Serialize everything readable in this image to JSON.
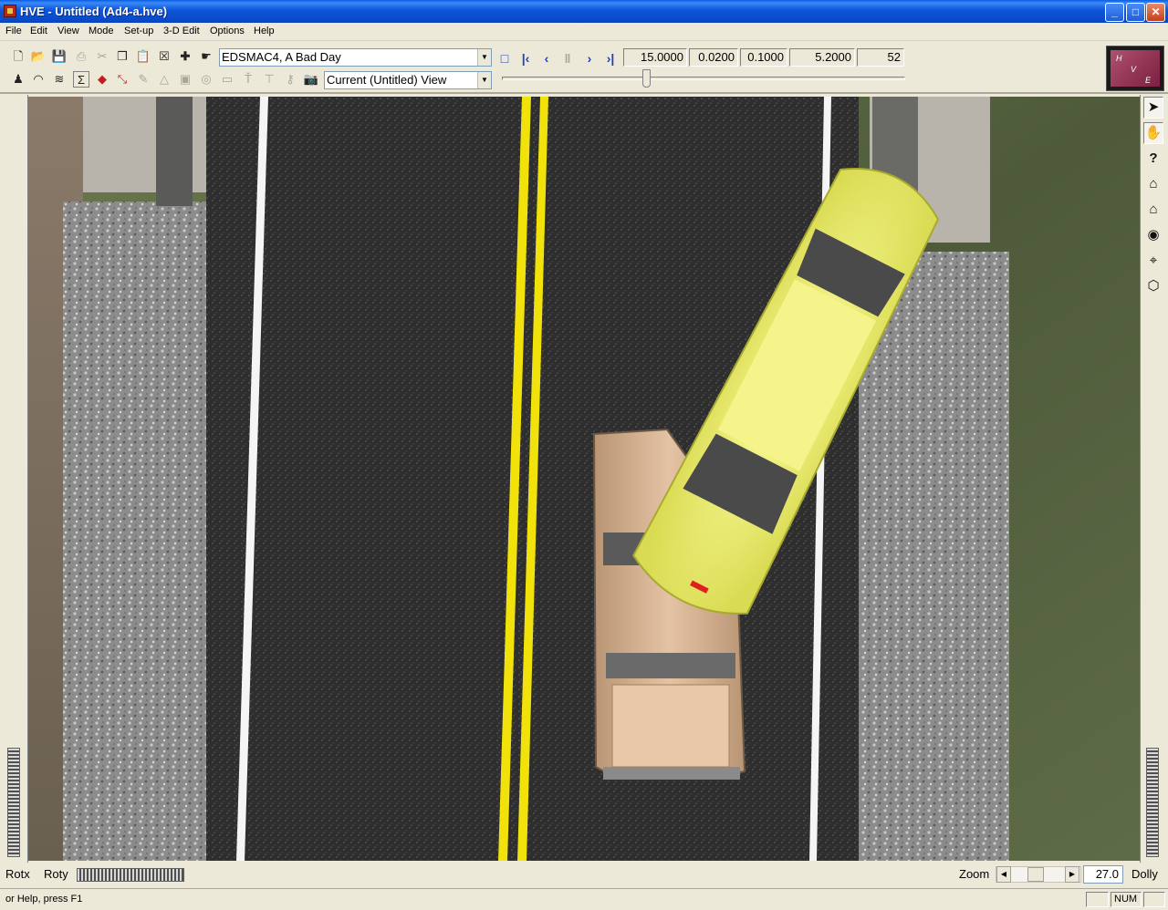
{
  "window": {
    "title": "HVE - Untitled (Ad4-a.hve)",
    "minimize": "_",
    "maximize": "□",
    "close": "✕"
  },
  "menu": [
    "File",
    "Edit",
    "View",
    "Mode",
    "Set-up",
    "3-D Edit",
    "Options",
    "Help"
  ],
  "toolbar": {
    "event_select": "EDSMAC4, A Bad Day",
    "view_select": "Current (Untitled) View",
    "playback": {
      "icons": [
        "stop-icon",
        "rewind-to-start-icon",
        "step-back-icon",
        "pause-icon",
        "step-forward-icon",
        "forward-to-end-icon"
      ],
      "fields": [
        "15.0000",
        "0.0200",
        "0.1000",
        "5.2000",
        "52"
      ]
    },
    "time_slider_position": 0.36,
    "logo_letters": [
      "H",
      "V",
      "E"
    ]
  },
  "colors": {
    "asphalt": "#2e2e2e",
    "shoulder": "#8a8a8a",
    "lane_line": "#f5f5f5",
    "center_line": "#f2e20c",
    "yellow_car": "#eef07a",
    "tan_car": "#d6b08a",
    "grass": "#5e6b48"
  },
  "side_tools": [
    "select-arrow-icon",
    "pan-hand-icon",
    "help-query-icon",
    "home-view-icon",
    "home-set-icon",
    "eye-view-icon",
    "target-crosshair-icon",
    "wireframe-box-icon"
  ],
  "bottom": {
    "rotx": "Rotx",
    "roty": "Roty",
    "zoom": "Zoom",
    "zoom_value": "27.0",
    "dolly": "Dolly"
  },
  "status": {
    "help": "or Help, press F1",
    "num": "NUM"
  }
}
